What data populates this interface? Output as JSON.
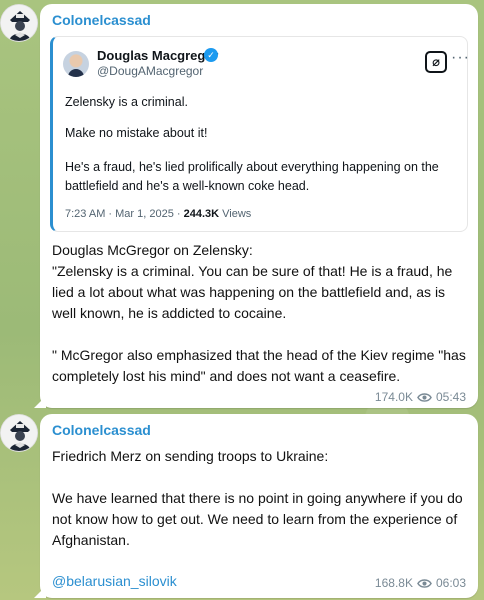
{
  "messages": [
    {
      "sender": "Colonelcassad",
      "tweet": {
        "name": "Douglas Macgregor",
        "handle": "@DougAMacgregor",
        "lines": [
          "Zelensky is a criminal.",
          "Make no mistake about it!",
          "He's a fraud, he's lied prolifically about everything happening on the",
          "battlefield and he's a well-known coke head."
        ],
        "time": "7:23 AM · Mar 1, 2025 · ",
        "views_count": "244.3K",
        "views_label": " Views"
      },
      "body": [
        "Douglas McGregor on Zelensky:",
        "\"Zelensky is a criminal. You can be sure of that! He is a fraud, he",
        "lied a lot about what was happening on the battlefield and, as is",
        "well known, he is addicted to cocaine.",
        "\" McGregor also emphasized that the head of the Kiev regime \"has",
        "completely lost his mind\" and does not want a ceasefire."
      ],
      "views": "174.0K",
      "time": "05:43"
    },
    {
      "sender": "Colonelcassad",
      "body": [
        "Friedrich Merz on sending troops to Ukraine:",
        "We have learned that there is no point in going anywhere if you do",
        "not know how to get out. We need to learn from the experience of",
        "Afghanistan."
      ],
      "link": "@belarusian_silovik",
      "views": "168.8K",
      "time": "06:03"
    }
  ],
  "colors": {
    "accent": "#2b8fd0",
    "verified": "#1d9bf0"
  },
  "icons": {
    "views": "eye-icon",
    "verified": "verified-badge-icon",
    "x": "x-logo-icon",
    "more": "more-icon"
  }
}
